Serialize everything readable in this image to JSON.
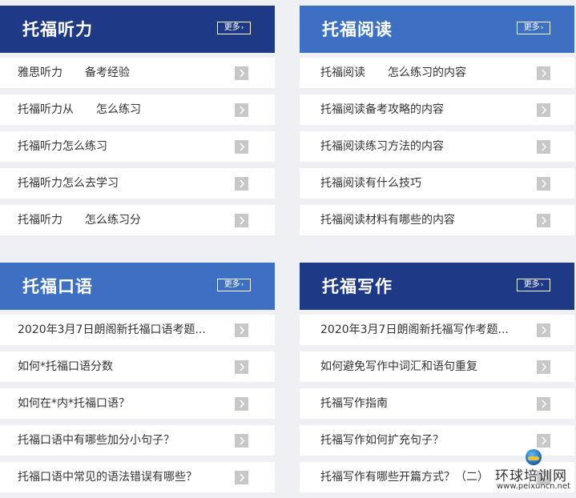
{
  "panels": [
    {
      "title": "托福听力",
      "more": "更多",
      "items": [
        "雅思听力　　备考经验",
        "托福听力从　　怎么练习",
        "托福听力怎么练习",
        "托福听力怎么去学习",
        "托福听力　　怎么练习分"
      ]
    },
    {
      "title": "托福阅读",
      "more": "更多",
      "items": [
        "托福阅读　　怎么练习的内容",
        "托福阅读备考攻略的内容",
        "托福阅读练习方法的内容",
        "托福阅读有什么技巧",
        "托福阅读材料有哪些的内容"
      ]
    },
    {
      "title": "托福口语",
      "more": "更多",
      "items": [
        "2020年3月7日朗阁新托福口语考题...",
        "如何*托福口语分数",
        "如何在*内*托福口语？",
        "托福口语中有哪些加分小句子？",
        "托福口语中常见的语法错误有哪些？"
      ]
    },
    {
      "title": "托福写作",
      "more": "更多",
      "items": [
        "2020年3月7日朗阁新托福写作考题...",
        "如何避免写作中词汇和语句重复",
        "托福写作指南",
        "托福写作如何扩充句子？",
        "托福写作有哪些开篇方式？（二）"
      ]
    }
  ],
  "logo": {
    "name": "环球培训网",
    "url": "www.peixuncn.net"
  },
  "colors": {
    "dark_header": "#1e3a86",
    "light_header": "#3d70c2",
    "chevron_bg": "#c8c8c8"
  }
}
